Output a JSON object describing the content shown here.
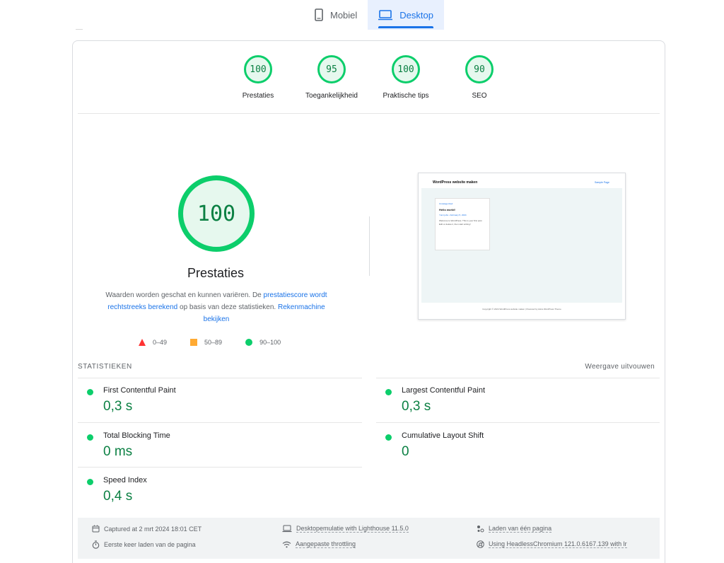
{
  "device_tabs": {
    "mobile_label": "Mobiel",
    "desktop_label": "Desktop"
  },
  "summary_gauges": [
    {
      "score": "100",
      "label": "Prestaties"
    },
    {
      "score": "95",
      "label": "Toegankelijkheid"
    },
    {
      "score": "100",
      "label": "Praktische tips"
    },
    {
      "score": "90",
      "label": "SEO"
    }
  ],
  "performance": {
    "score": "100",
    "title": "Prestaties",
    "desc_text1": "Waarden worden geschat en kunnen variëren. De ",
    "desc_link1": "prestatiescore wordt rechtstreeks berekend",
    "desc_text2": " op basis van deze statistieken. ",
    "desc_link2": "Rekenmachine bekijken"
  },
  "legend": {
    "fail": "0–49",
    "average": "50–89",
    "pass": "90–100"
  },
  "thumbnail": {
    "site_title": "WordPress website maken",
    "nav_link": "Sample Page",
    "category": "Uncategorized",
    "post_title": "Hello world!",
    "post_meta": "Yumi jobs • February 5, 2024",
    "post_text": "Welcome to WordPress. This is your first post. Edit or delete it, then start writing!",
    "footer": "Copyright © 2024 WordPress website maken | Powered by Astra WordPress Theme"
  },
  "statistics": {
    "heading": "STATISTIEKEN",
    "expand_label": "Weergave uitvouwen",
    "metrics": [
      {
        "name": "First Contentful Paint",
        "value": "0,3 s",
        "status": "pass"
      },
      {
        "name": "Largest Contentful Paint",
        "value": "0,3 s",
        "status": "pass"
      },
      {
        "name": "Total Blocking Time",
        "value": "0 ms",
        "status": "pass"
      },
      {
        "name": "Cumulative Layout Shift",
        "value": "0",
        "status": "pass"
      },
      {
        "name": "Speed Index",
        "value": "0,4 s",
        "status": "pass"
      }
    ]
  },
  "runtime": {
    "captured": "Captured at 2 mrt 2024 18:01 CET",
    "emulation": "Desktopemulatie with Lighthouse 11.5.0",
    "page_load": "Laden van één pagina",
    "initial_load": "Eerste keer laden van de pagina",
    "throttling": "Aangepaste throttling",
    "browser": "Using HeadlessChromium 121.0.6167.139 with lr"
  },
  "colors": {
    "pass": "#0cce6b",
    "pass_text": "#0b8043",
    "average": "#ffaa33",
    "fail": "#ff3333",
    "accent": "#1a73e8"
  },
  "icons": {
    "mobile": "smartphone-icon",
    "desktop": "laptop-icon",
    "calendar": "calendar-icon",
    "timer": "timer-icon",
    "emulation": "laptop-icon",
    "throttling": "wifi-icon",
    "page_load": "nodes-icon",
    "browser": "chrome-icon"
  }
}
